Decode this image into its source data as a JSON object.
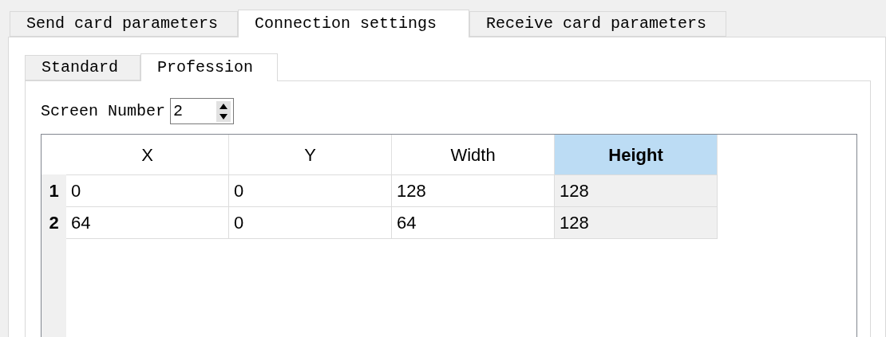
{
  "tabs": [
    {
      "label": "Send card parameters",
      "selected": false
    },
    {
      "label": "Connection settings",
      "selected": true
    },
    {
      "label": "Receive card parameters",
      "selected": false
    }
  ],
  "subtabs": [
    {
      "label": "Standard",
      "selected": false
    },
    {
      "label": "Profession",
      "selected": true
    }
  ],
  "screen_number": {
    "label": "Screen Number",
    "value": "2"
  },
  "table": {
    "columns": [
      {
        "label": "X",
        "selected": false
      },
      {
        "label": "Y",
        "selected": false
      },
      {
        "label": "Width",
        "selected": false
      },
      {
        "label": "Height",
        "selected": true
      }
    ],
    "rows": [
      {
        "header": "1",
        "cells": [
          "0",
          "0",
          "128",
          "128"
        ]
      },
      {
        "header": "2",
        "cells": [
          "64",
          "0",
          "64",
          "128"
        ]
      }
    ]
  }
}
